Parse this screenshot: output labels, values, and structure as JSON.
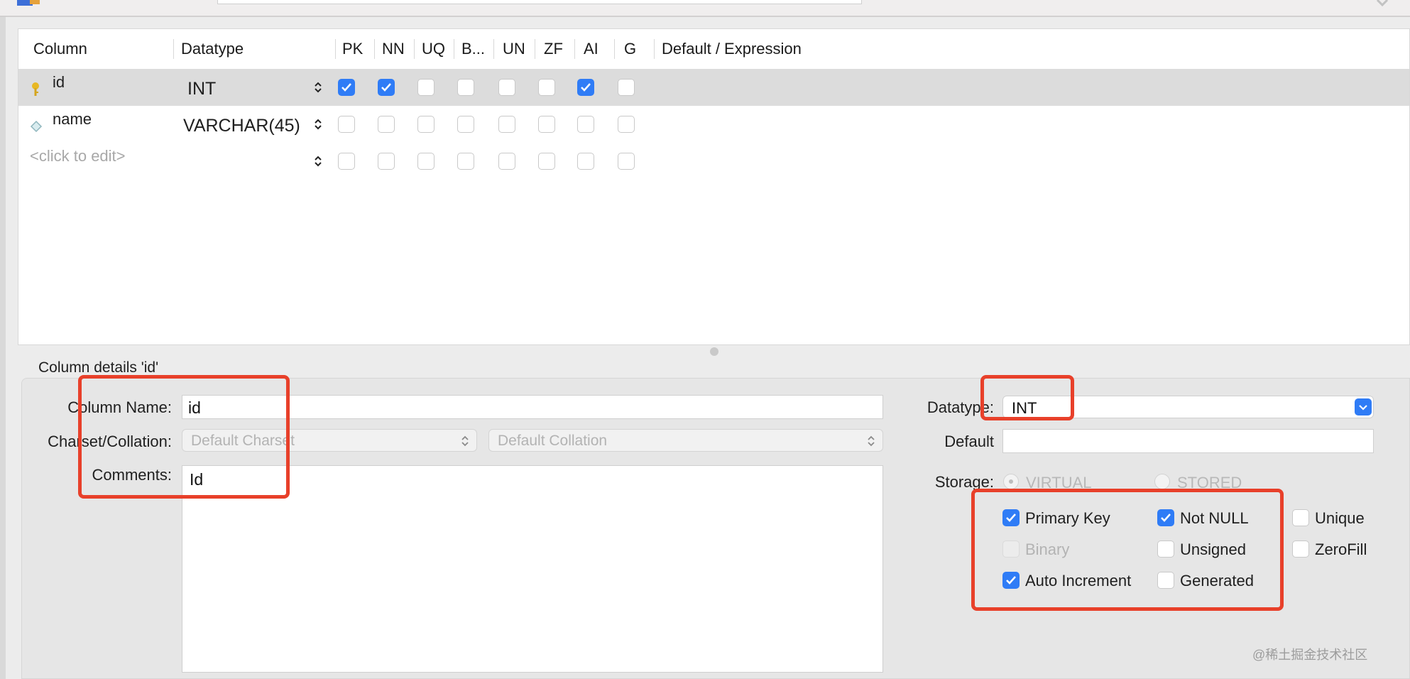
{
  "grid": {
    "headers": [
      "Column",
      "Datatype",
      "PK",
      "NN",
      "UQ",
      "B...",
      "UN",
      "ZF",
      "AI",
      "G",
      "Default / Expression"
    ],
    "rows": [
      {
        "name": "id",
        "type": "INT",
        "icon": "primary-key-icon",
        "flags": [
          true,
          true,
          false,
          false,
          false,
          false,
          true,
          false
        ],
        "selected": true
      },
      {
        "name": "name",
        "type": "VARCHAR(45)",
        "icon": "column-diamond-icon",
        "flags": [
          false,
          false,
          false,
          false,
          false,
          false,
          false,
          false
        ],
        "selected": false
      }
    ],
    "new_row_placeholder": "<click to edit>"
  },
  "details": {
    "title": "Column details 'id'",
    "column_name_label": "Column Name:",
    "column_name_value": "id",
    "charset_label": "Charset/Collation:",
    "charset_value": "Default Charset",
    "collation_value": "Default Collation",
    "comments_label": "Comments:",
    "comments_value": "Id",
    "datatype_label": "Datatype:",
    "datatype_value": "INT",
    "default_label": "Default",
    "default_value": "",
    "storage_label": "Storage:",
    "storage_virtual": "VIRTUAL",
    "storage_stored": "STORED",
    "flags": {
      "primary_key": {
        "label": "Primary Key",
        "checked": true
      },
      "not_null": {
        "label": "Not NULL",
        "checked": true
      },
      "unique": {
        "label": "Unique",
        "checked": false
      },
      "binary": {
        "label": "Binary",
        "checked": false,
        "disabled": true
      },
      "unsigned": {
        "label": "Unsigned",
        "checked": false
      },
      "zerofill": {
        "label": "ZeroFill",
        "checked": false
      },
      "auto_increment": {
        "label": "Auto Increment",
        "checked": true
      },
      "generated": {
        "label": "Generated",
        "checked": false
      }
    }
  },
  "watermark": "@稀土掘金技术社区",
  "colors": {
    "accent": "#2f7cf6",
    "highlight": "#e8402a"
  }
}
